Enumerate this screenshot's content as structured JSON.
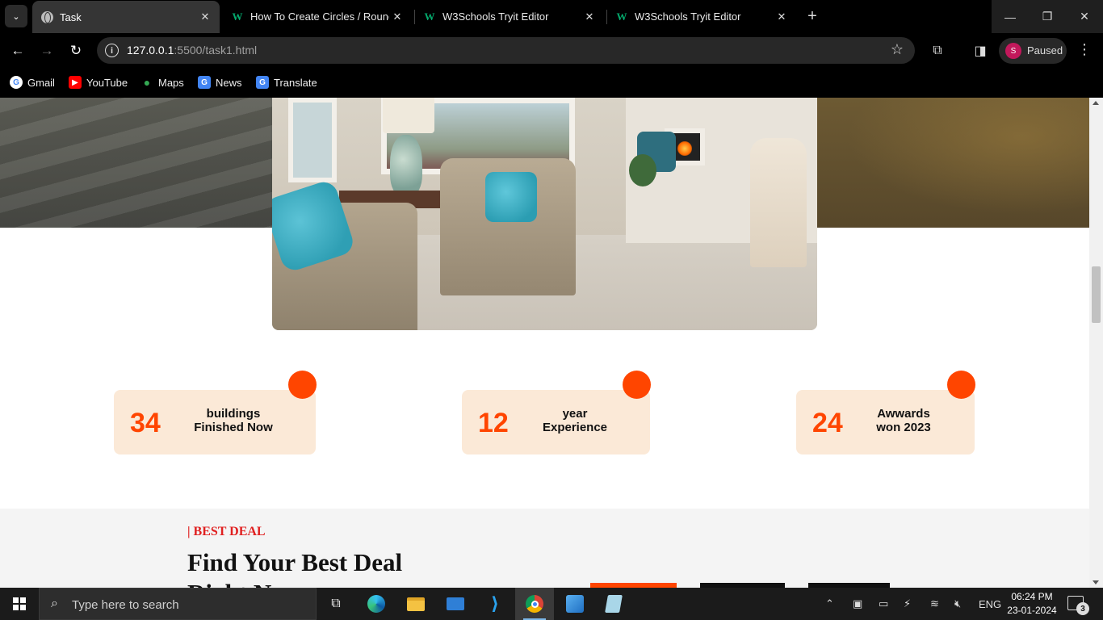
{
  "browser": {
    "tabs": [
      {
        "title": "Task",
        "favicon": "globe-icon",
        "active": true
      },
      {
        "title": "How To Create Circles / Round",
        "favicon": "w3schools-icon",
        "active": false
      },
      {
        "title": "W3Schools Tryit Editor",
        "favicon": "w3schools-icon",
        "active": false
      },
      {
        "title": "W3Schools Tryit Editor",
        "favicon": "w3schools-icon",
        "active": false
      }
    ],
    "url_host": "127.0.0.1",
    "url_rest": ":5500/task1.html",
    "profile_initial": "S",
    "profile_status": "Paused",
    "bookmarks": [
      {
        "label": "Gmail",
        "icon": "google-icon",
        "color": "#4285f4"
      },
      {
        "label": "YouTube",
        "icon": "youtube-icon",
        "color": "#ff0000"
      },
      {
        "label": "Maps",
        "icon": "maps-icon",
        "color": "#34a853"
      },
      {
        "label": "News",
        "icon": "news-icon",
        "color": "#4285f4"
      },
      {
        "label": "Translate",
        "icon": "translate-icon",
        "color": "#4285f4"
      }
    ]
  },
  "page": {
    "stats": [
      {
        "number": "34",
        "line1": "buildings",
        "line2": "Finished Now"
      },
      {
        "number": "12",
        "line1": "year",
        "line2": "Experience"
      },
      {
        "number": "24",
        "line1": "Awwards",
        "line2": "won 2023"
      }
    ],
    "deal": {
      "kicker": "| BEST DEAL",
      "heading": "Find Your Best Deal Right Now..."
    },
    "colors": {
      "accent": "#ff4500",
      "stat_bg": "#fbe9d7",
      "kicker": "#e02020"
    }
  },
  "taskbar": {
    "search_placeholder": "Type here to search",
    "language": "ENG",
    "time": "06:24 PM",
    "date": "23-01-2024",
    "notification_count": "3"
  }
}
